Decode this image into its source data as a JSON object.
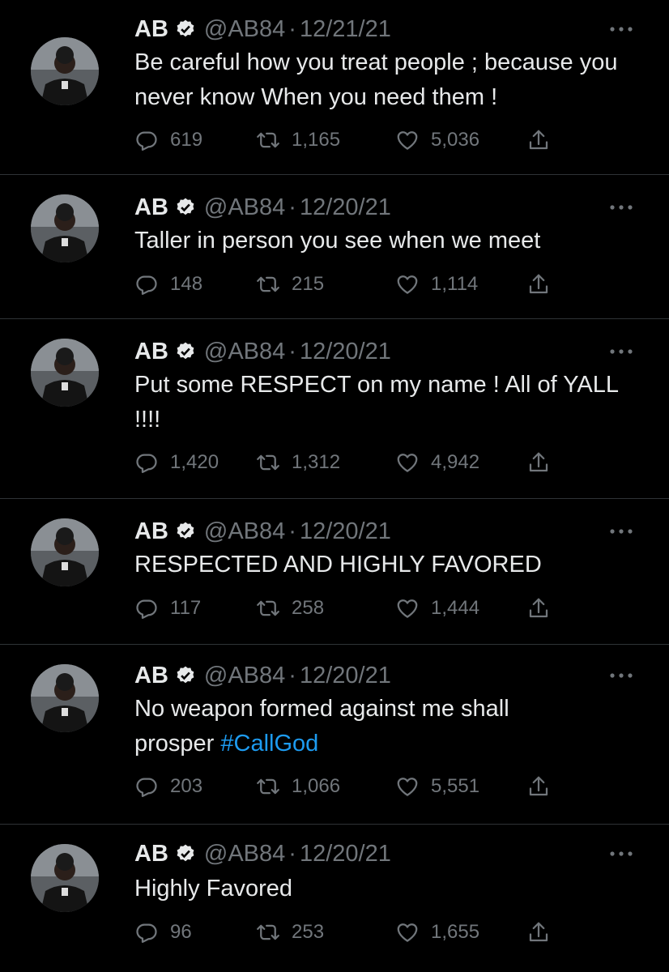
{
  "tweets": [
    {
      "name": "AB",
      "handle": "@AB84",
      "date": "12/21/21",
      "text": "Be careful how you treat people ; because you never know When you need them !",
      "hashtag": "",
      "replies": "619",
      "retweets": "1,165",
      "likes": "5,036"
    },
    {
      "name": "AB",
      "handle": "@AB84",
      "date": "12/20/21",
      "text": "Taller in person you see when we meet",
      "hashtag": "",
      "replies": "148",
      "retweets": "215",
      "likes": "1,114"
    },
    {
      "name": "AB",
      "handle": "@AB84",
      "date": "12/20/21",
      "text": "Put some RESPECT  on my name ! All of YALL !!!!",
      "hashtag": "",
      "replies": "1,420",
      "retweets": "1,312",
      "likes": "4,942"
    },
    {
      "name": "AB",
      "handle": "@AB84",
      "date": "12/20/21",
      "text": "RESPECTED AND HIGHLY FAVORED",
      "hashtag": "",
      "replies": "117",
      "retweets": "258",
      "likes": "1,444"
    },
    {
      "name": "AB",
      "handle": "@AB84",
      "date": "12/20/21",
      "text": "No weapon formed against me shall prosper ",
      "hashtag": "#CallGod",
      "replies": "203",
      "retweets": "1,066",
      "likes": "5,551"
    },
    {
      "name": "AB",
      "handle": "@AB84",
      "date": "12/20/21",
      "text": "Highly Favored",
      "hashtag": "",
      "replies": "96",
      "retweets": "253",
      "likes": "1,655"
    }
  ],
  "separator": "·",
  "colors": {
    "background": "#000000",
    "text": "#e7e9ea",
    "secondary": "#71767b",
    "link": "#1d9bf0",
    "divider": "#2f3336"
  },
  "icons": {
    "verified": "verified-badge-icon",
    "more": "more-options-icon",
    "reply": "reply-icon",
    "retweet": "retweet-icon",
    "like": "heart-icon",
    "share": "share-icon"
  }
}
